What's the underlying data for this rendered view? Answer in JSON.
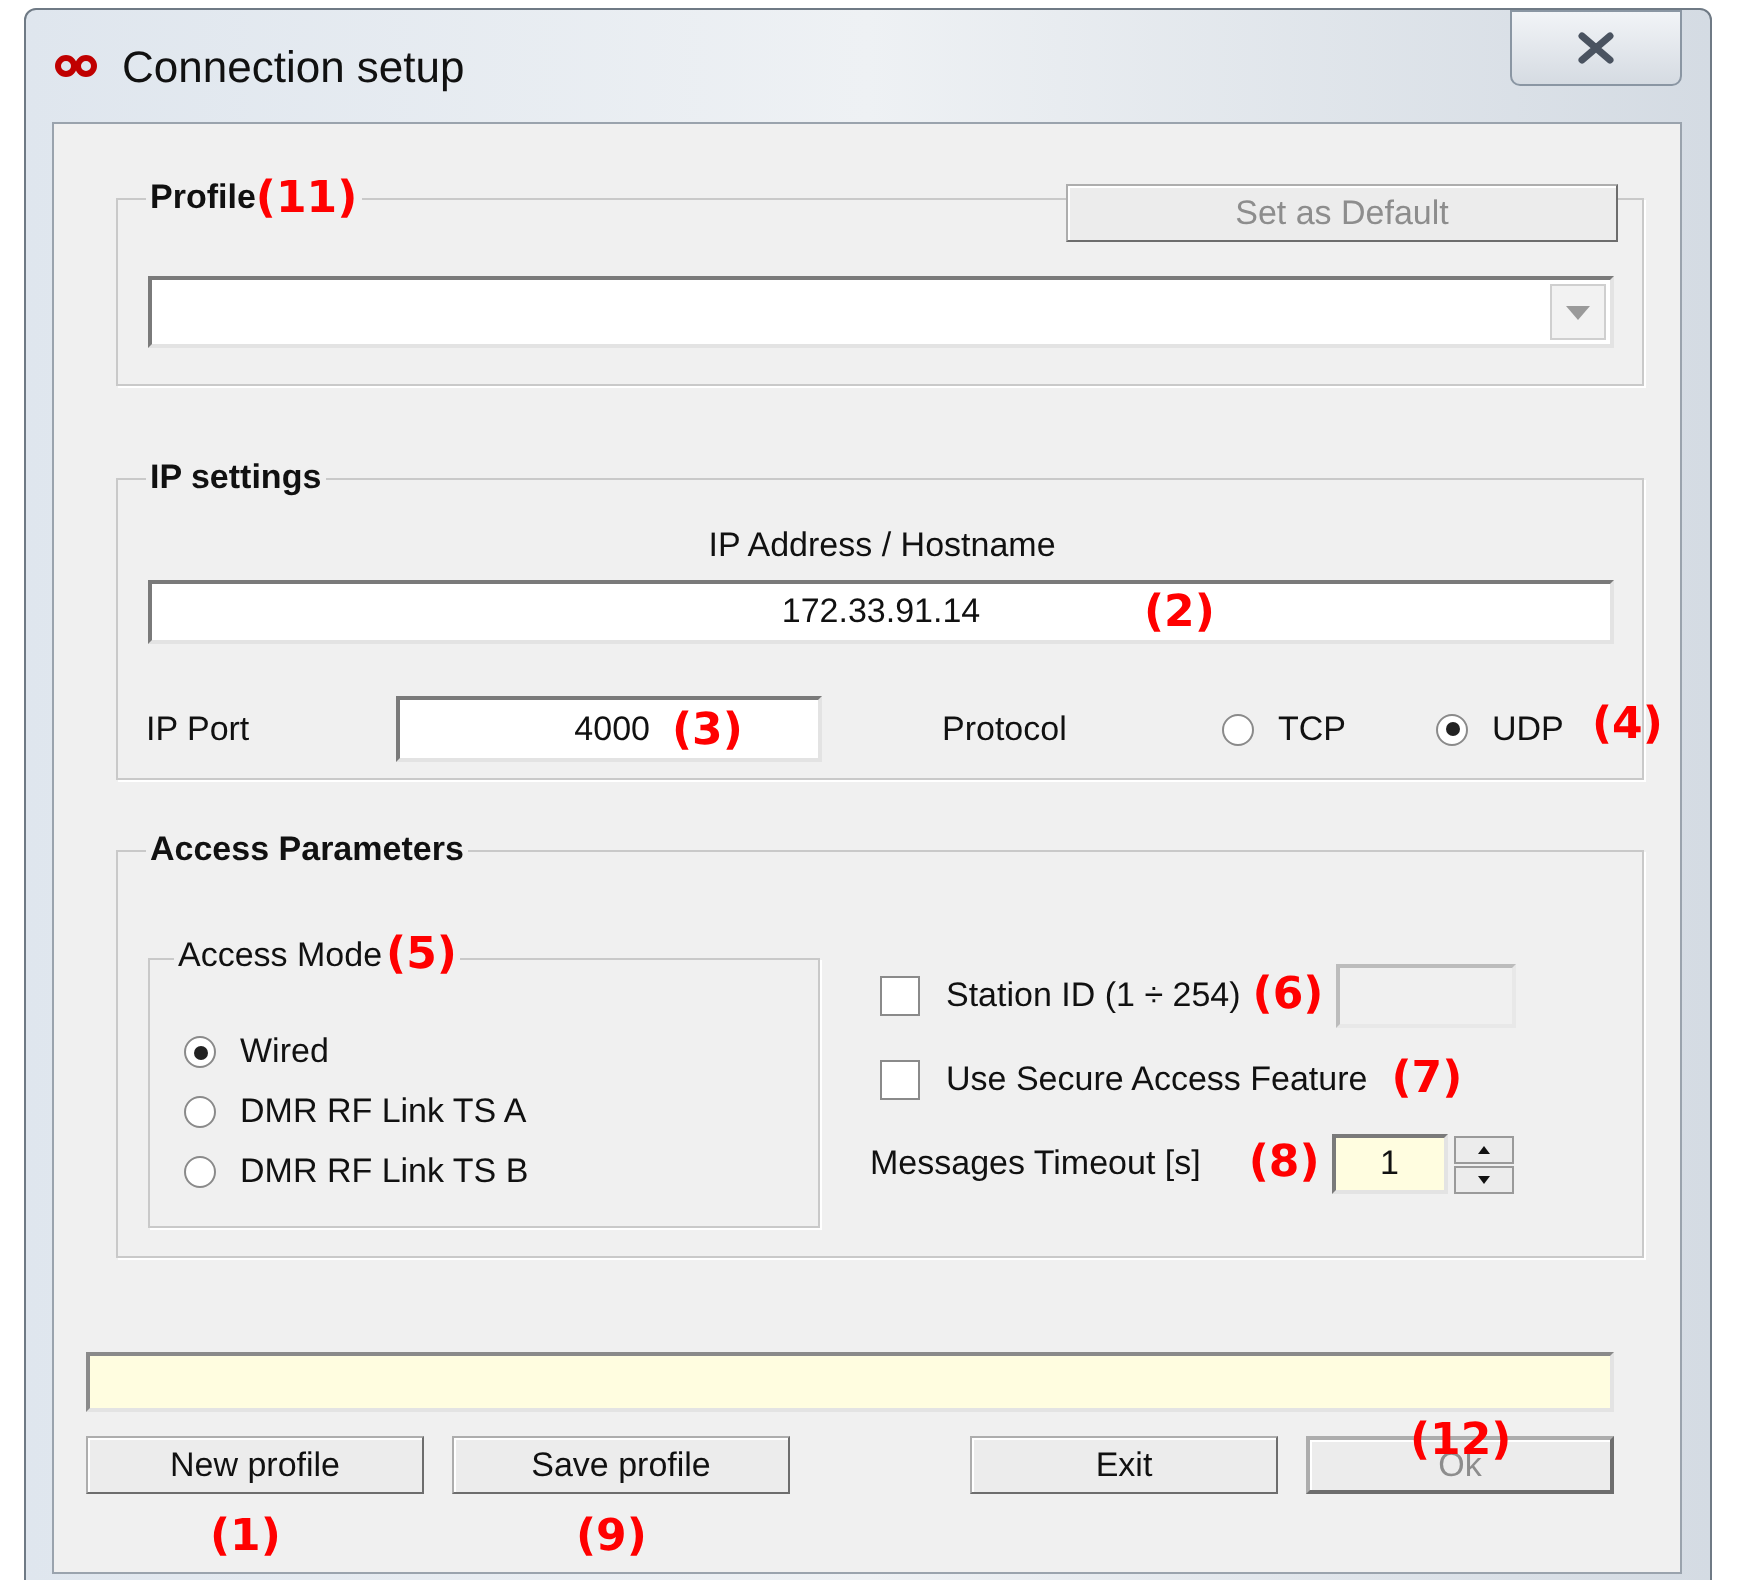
{
  "window": {
    "title": "Connection setup"
  },
  "profile": {
    "title": "Profile",
    "annotation": "(11)",
    "default_button": {
      "label": "Set as Default",
      "disabled": true
    }
  },
  "ip_settings": {
    "title": "IP settings",
    "address_label": "IP Address / Hostname",
    "address": "172.33.91.14",
    "address_annotation": "(2)",
    "port_label": "IP Port",
    "port": "4000",
    "port_annotation": "(3)",
    "protocol_label": "Protocol",
    "protocols": [
      {
        "label": "TCP",
        "selected": false
      },
      {
        "label": "UDP",
        "selected": true
      }
    ],
    "protocol_annotation": "(4)"
  },
  "access": {
    "title": "Access Parameters",
    "mode_title": "Access Mode",
    "mode_annotation": "(5)",
    "modes": [
      {
        "label": "Wired",
        "selected": true
      },
      {
        "label": "DMR RF Link TS A",
        "selected": false
      },
      {
        "label": "DMR RF Link TS B",
        "selected": false
      }
    ],
    "station_id": {
      "label": "Station ID (1 ÷ 254)",
      "checked": false,
      "annotation": "(6)"
    },
    "secure": {
      "label": "Use Secure Access Feature",
      "checked": false,
      "annotation": "(7)"
    },
    "timeout": {
      "label": "Messages Timeout [s]",
      "annotation": "(8)",
      "value": "1"
    }
  },
  "buttons": [
    {
      "label": "New profile",
      "disabled": false,
      "annotation": "(1)"
    },
    {
      "label": "Save profile",
      "disabled": false,
      "annotation": "(9)"
    },
    {
      "label": "Exit",
      "disabled": false
    },
    {
      "label": "Ok",
      "disabled": true,
      "annotation": "(12)"
    }
  ]
}
